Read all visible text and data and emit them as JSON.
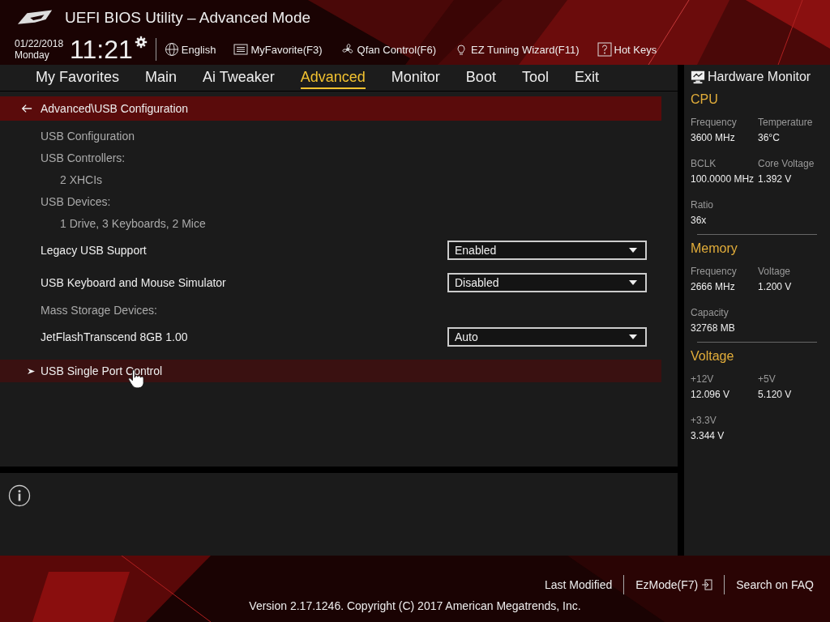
{
  "window": {
    "title": "UEFI BIOS Utility – Advanced Mode"
  },
  "clock": {
    "date": "01/22/2018",
    "day": "Monday",
    "time": "11:21"
  },
  "toolbar": [
    {
      "kind": "globe",
      "label": "English"
    },
    {
      "kind": "list",
      "label": "MyFavorite(F3)"
    },
    {
      "kind": "fan",
      "label": "Qfan Control(F6)"
    },
    {
      "kind": "bulb",
      "label": "EZ Tuning Wizard(F11)"
    },
    {
      "kind": "help",
      "label": "Hot Keys"
    }
  ],
  "tabs": [
    {
      "label": "My Favorites",
      "selected": false
    },
    {
      "label": "Main",
      "selected": false
    },
    {
      "label": "Ai Tweaker",
      "selected": false
    },
    {
      "label": "Advanced",
      "selected": true
    },
    {
      "label": "Monitor",
      "selected": false
    },
    {
      "label": "Boot",
      "selected": false
    },
    {
      "label": "Tool",
      "selected": false
    },
    {
      "label": "Exit",
      "selected": false
    }
  ],
  "breadcrumb": "Advanced\\USB Configuration",
  "settings": [
    {
      "kind": "label",
      "text": "USB Configuration"
    },
    {
      "kind": "label",
      "text": "USB Controllers:"
    },
    {
      "kind": "value",
      "text": "2 XHCIs"
    },
    {
      "kind": "label",
      "text": "USB Devices:"
    },
    {
      "kind": "value",
      "text": "1 Drive, 3 Keyboards, 2 Mice"
    },
    {
      "kind": "dropdown",
      "text": "Legacy USB Support",
      "value": "Enabled"
    },
    {
      "kind": "dropdown",
      "text": "USB Keyboard and Mouse Simulator",
      "value": "Disabled"
    },
    {
      "kind": "label",
      "text": "Mass Storage Devices:"
    },
    {
      "kind": "dropdown",
      "text": "JetFlashTranscend 8GB 1.00",
      "value": "Auto"
    },
    {
      "kind": "submenu",
      "text": "USB Single Port Control",
      "selected": true
    }
  ],
  "hardware_monitor": {
    "title": "Hardware Monitor",
    "sections": [
      {
        "title": "CPU",
        "fields": [
          {
            "label": "Frequency",
            "value": "3600 MHz"
          },
          {
            "label": "Temperature",
            "value": "36°C"
          },
          {
            "label": "BCLK",
            "value": "100.0000 MHz"
          },
          {
            "label": "Core Voltage",
            "value": "1.392 V"
          },
          {
            "label": "Ratio",
            "value": "36x"
          }
        ]
      },
      {
        "title": "Memory",
        "fields": [
          {
            "label": "Frequency",
            "value": "2666 MHz"
          },
          {
            "label": "Voltage",
            "value": "1.200 V"
          },
          {
            "label": "Capacity",
            "value": "32768 MB"
          }
        ]
      },
      {
        "title": "Voltage",
        "fields": [
          {
            "label": "+12V",
            "value": "12.096 V"
          },
          {
            "label": "+5V",
            "value": "5.120 V"
          },
          {
            "label": "+3.3V",
            "value": "3.344 V"
          }
        ]
      }
    ]
  },
  "footer": {
    "links": [
      {
        "kind": "plain",
        "label": "Last Modified"
      },
      {
        "kind": "exit",
        "label": "EzMode(F7)"
      },
      {
        "kind": "plain",
        "label": "Search on FAQ"
      }
    ],
    "copyright": "Version 2.17.1246. Copyright (C) 2017 American Megatrends, Inc."
  }
}
